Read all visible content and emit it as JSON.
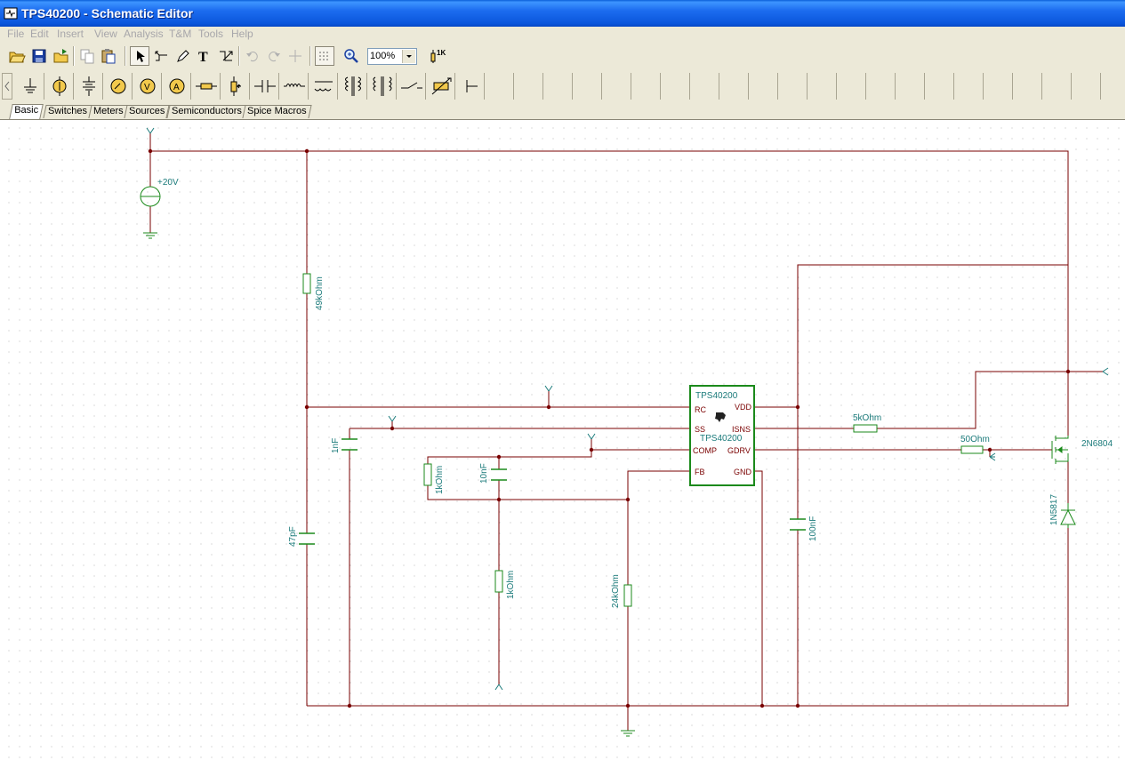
{
  "window": {
    "title": "TPS40200 - Schematic Editor"
  },
  "menu": [
    "File",
    "Edit",
    "Insert",
    "View",
    "Analysis",
    "T&M",
    "Tools",
    "Help"
  ],
  "toolbar": {
    "zoom": "100%",
    "buttons": [
      "open-folder-icon",
      "save-icon",
      "open-icon",
      "copy-icon",
      "paste-icon",
      "select-arrow-icon",
      "wire-icon",
      "pencil-icon",
      "text-icon",
      "delete-wire-icon",
      "undo-icon",
      "redo-icon",
      "grid-snap-icon",
      "grid-dots-icon",
      "zoom-icon",
      "component-properties-icon"
    ]
  },
  "palette": [
    "ground-icon",
    "current-source-icon",
    "battery-icon",
    "voltmeter-icon",
    "voltage-meter-icon",
    "ammeter-icon",
    "resistor-icon",
    "potentiometer-icon",
    "capacitor-icon",
    "inductor-icon",
    "transformer-icon",
    "coupled-inductor-icon",
    "switch-transformer-icon",
    "switch-icon",
    "variable-resistor-icon",
    "terminal-icon"
  ],
  "tabs": [
    "Basic",
    "Switches",
    "Meters",
    "Sources",
    "Semiconductors",
    "Spice Macros"
  ],
  "active_tab": "Basic",
  "schematic": {
    "source_label": "+20V",
    "ic": {
      "name": "TPS40200",
      "subname": "TPS40200",
      "pins_left": [
        "RC",
        "SS",
        "COMP",
        "FB"
      ],
      "pins_right": [
        "VDD",
        "ISNS",
        "GDRV",
        "GND"
      ]
    },
    "components": {
      "r_49k": "49kOhm",
      "c_1n": "1nF",
      "c_47p": "47pF",
      "r_1k_a": "1kOhm",
      "c_10n": "10nF",
      "r_1k_b": "1kOhm",
      "r_24k": "24kOhm",
      "c_100n": "100nF",
      "r_5k": "5kOhm",
      "r_50": "50Ohm",
      "mosfet": "2N6804",
      "diode": "1N5817"
    }
  }
}
